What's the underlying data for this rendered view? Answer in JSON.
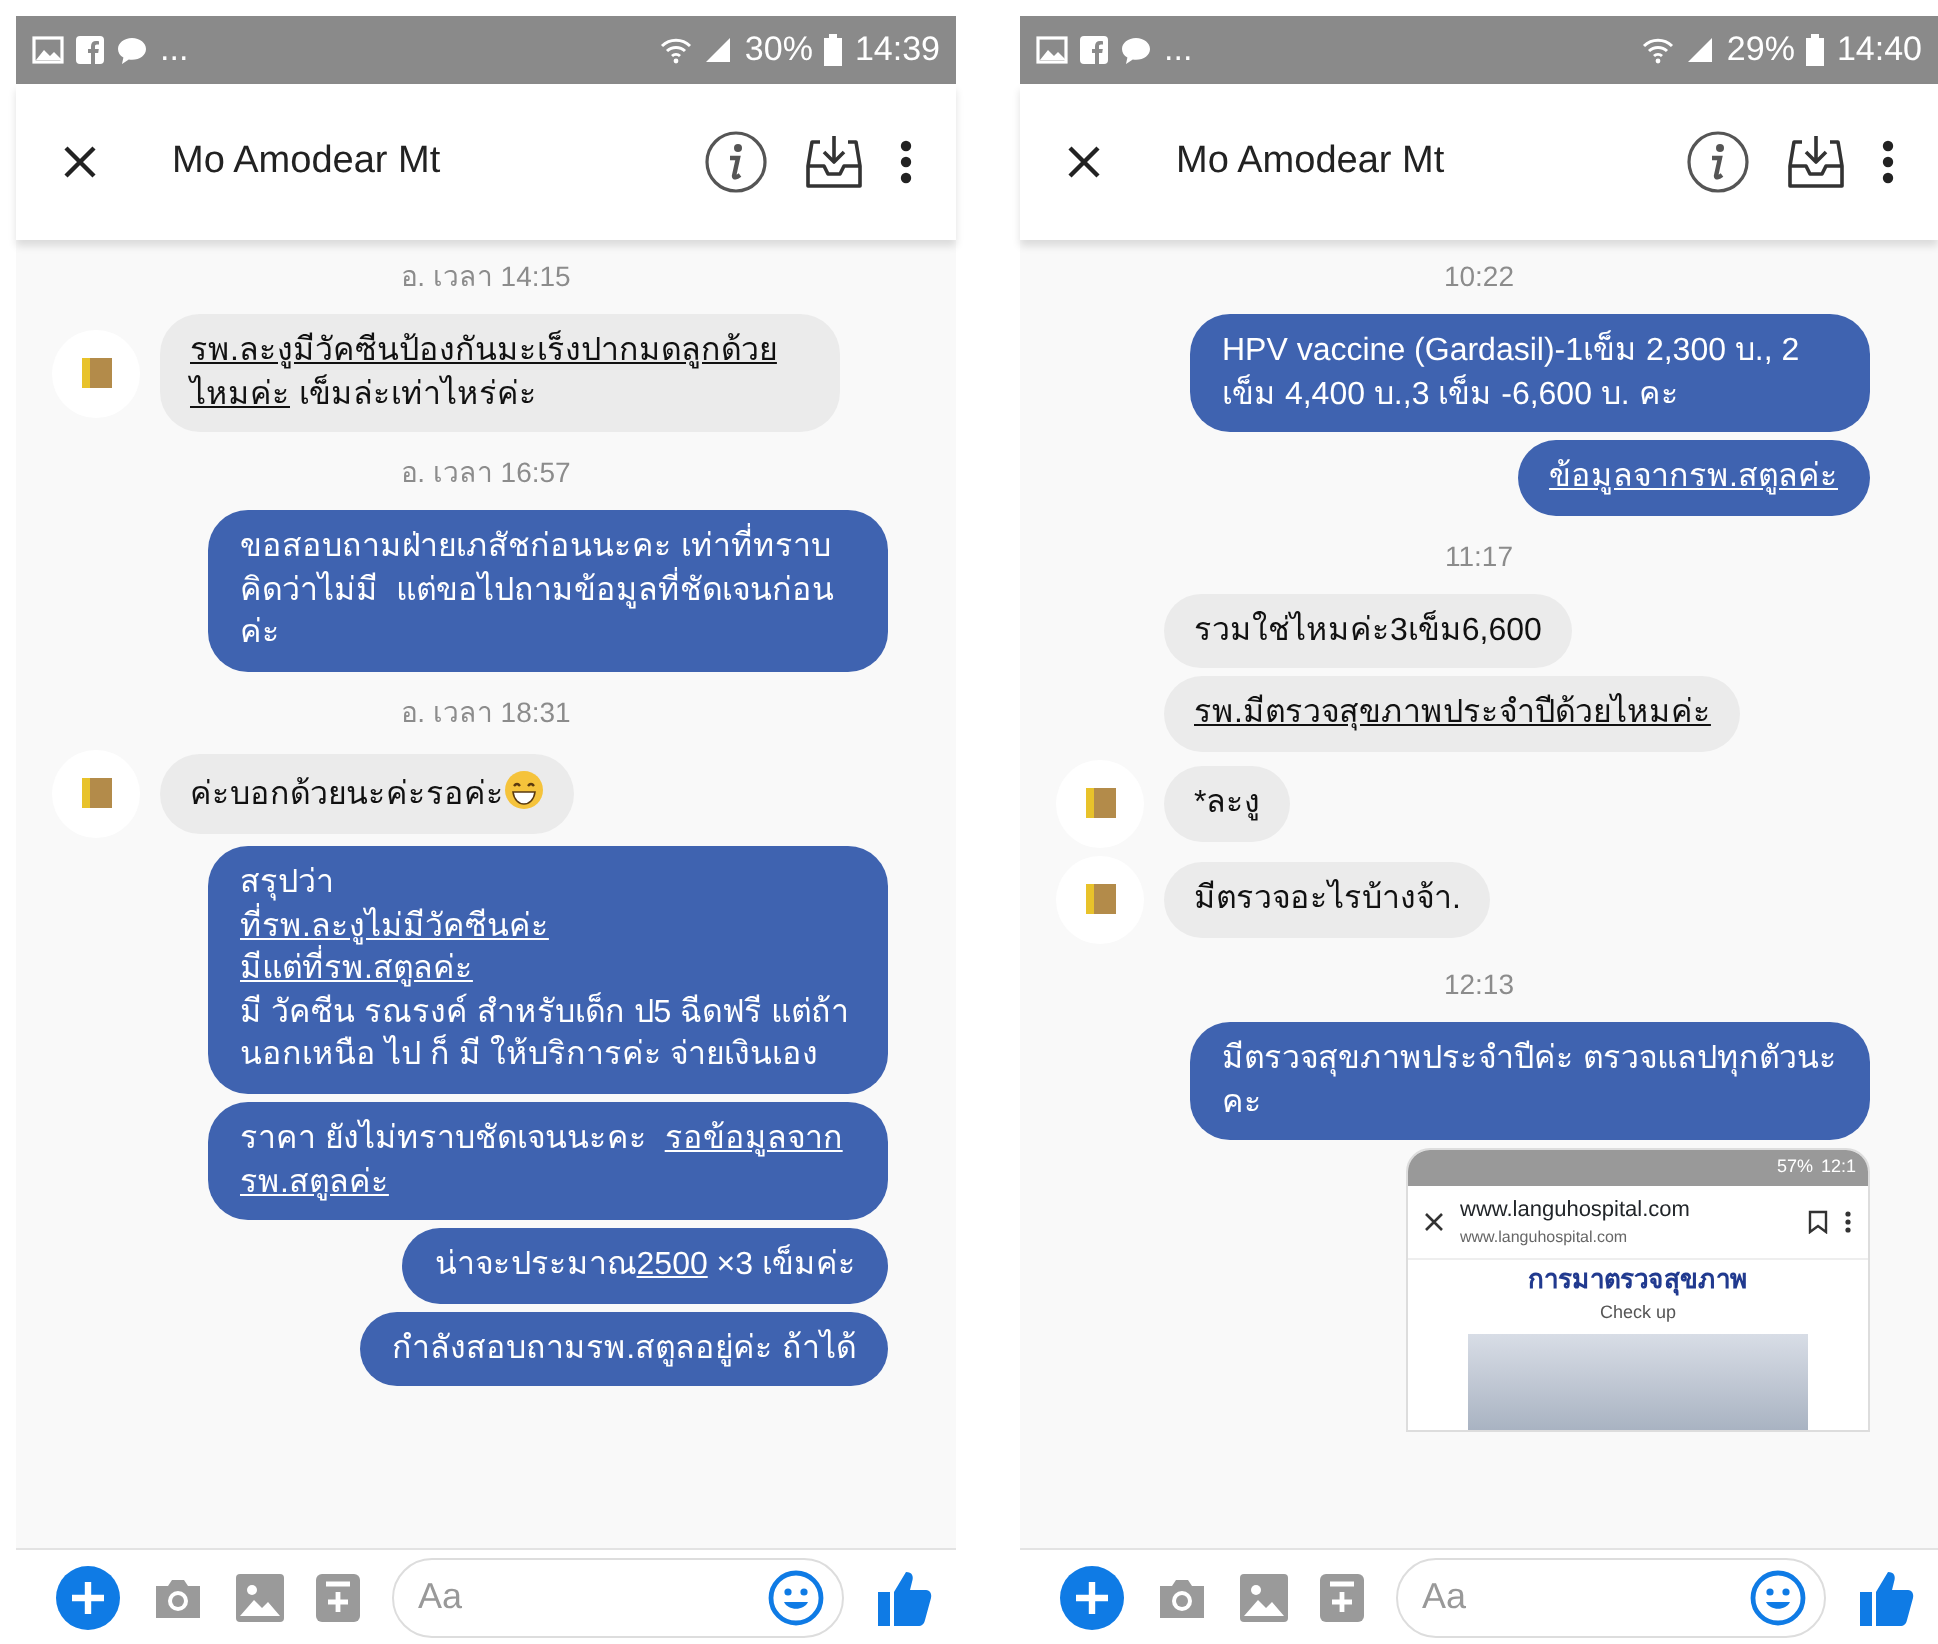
{
  "screens": [
    {
      "status_bar": {
        "more": "...",
        "battery": "30%",
        "time": "14:39"
      },
      "header": {
        "title": "Mo Amodear Mt"
      },
      "messages": [
        {
          "kind": "timestamp",
          "text": "อ. เวลา 14:15"
        },
        {
          "kind": "incoming",
          "avatar": true,
          "segments": [
            {
              "text": "รพ.ละงูมีวัคซีนป้องกันมะเร็งปากมดลูกด้วยไหมค่ะ",
              "underline": true
            },
            {
              "text": " เข็มล่ะเท่าไหร่ค่ะ",
              "underline": false
            }
          ]
        },
        {
          "kind": "timestamp",
          "text": "อ. เวลา 16:57"
        },
        {
          "kind": "outgoing",
          "segments": [
            {
              "text": "ขอสอบถามฝ่ายเภสัชก่อนนะคะ เท่าที่ทราบคิดว่าไม่มี  แต่ขอไปถามข้อมูลที่ชัดเจนก่อนค่ะ",
              "underline": false
            }
          ]
        },
        {
          "kind": "timestamp",
          "text": "อ. เวลา 18:31"
        },
        {
          "kind": "incoming",
          "avatar": true,
          "trailing_emoji": true,
          "segments": [
            {
              "text": "ค่ะบอกด้วยนะค่ะรอค่ะ",
              "underline": false
            }
          ]
        },
        {
          "kind": "outgoing",
          "paragraphs": [
            {
              "text": "สรุปว่า",
              "underline": false
            },
            {
              "text": "ที่รพ.ละงูไม่มีวัคซีนค่ะ",
              "underline": true
            },
            {
              "text": "มีแต่ที่รพ.สตูลค่ะ",
              "underline": true
            },
            {
              "text": "มี วัคซีน รณรงค์ สำหรับเด็ก ป5 ฉีดฟรี แต่ถ้านอกเหนือ ไป ก็ มี ให้บริการค่ะ จ่ายเงินเอง",
              "underline": false
            }
          ]
        },
        {
          "kind": "outgoing",
          "segments": [
            {
              "text": "ราคา ยังไม่ทราบชัดเจนนะคะ  ",
              "underline": false
            },
            {
              "text": "รอข้อมูลจากรพ.สตูลค่ะ",
              "underline": true
            }
          ]
        },
        {
          "kind": "outgoing",
          "segments": [
            {
              "text": "น่าจะประมาณ",
              "underline": false
            },
            {
              "text": "2500",
              "underline": true
            },
            {
              "text": " ×3 เข็มค่ะ",
              "underline": false
            }
          ]
        },
        {
          "kind": "outgoing",
          "segments": [
            {
              "text": "กำลังสอบถามรพ.สตูลอยู่ค่ะ ถ้าได้",
              "underline": false
            }
          ]
        }
      ],
      "composer": {
        "placeholder": "Aa"
      }
    },
    {
      "status_bar": {
        "more": "...",
        "battery": "29%",
        "time": "14:40"
      },
      "header": {
        "title": "Mo Amodear Mt"
      },
      "messages": [
        {
          "kind": "timestamp",
          "text": "10:22"
        },
        {
          "kind": "outgoing",
          "segments": [
            {
              "text": "HPV vaccine (Gardasil)-1เข็ม 2,300 บ., 2 เข็ม 4,400 บ.,3 เข็ม -6,600 บ. คะ",
              "underline": false
            }
          ]
        },
        {
          "kind": "outgoing",
          "segments": [
            {
              "text": "ข้อมูลจากรพ.สตูลค่ะ",
              "underline": true
            }
          ]
        },
        {
          "kind": "timestamp",
          "text": "11:17"
        },
        {
          "kind": "incoming",
          "avatar": false,
          "segments": [
            {
              "text": "รวมใช่ไหมค่ะ3เข็ม6,600",
              "underline": false
            }
          ]
        },
        {
          "kind": "incoming",
          "avatar": false,
          "segments": [
            {
              "text": "รพ.มีตรวจสุขภาพประจำปีด้วยไหมค่ะ",
              "underline": true
            }
          ]
        },
        {
          "kind": "incoming",
          "avatar": true,
          "segments": [
            {
              "text": "*ละงู",
              "underline": false
            }
          ]
        },
        {
          "kind": "incoming",
          "avatar": true,
          "segments": [
            {
              "text": "มีตรวจอะไรบ้างจ้า.",
              "underline": false
            }
          ]
        },
        {
          "kind": "timestamp",
          "text": "12:13"
        },
        {
          "kind": "outgoing",
          "segments": [
            {
              "text": "มีตรวจสุขภาพประจำปีค่ะ ตรวจแลปทุกตัวนะคะ",
              "underline": false
            }
          ]
        },
        {
          "kind": "screenshot",
          "battery": "57%",
          "time": "12:1",
          "url": "www.languhospital.com",
          "url_small": "www.languhospital.com",
          "banner_title": "การมาตรวจสุขภาพ",
          "banner_subtitle": "Check up"
        }
      ],
      "composer": {
        "placeholder": "Aa"
      }
    }
  ]
}
